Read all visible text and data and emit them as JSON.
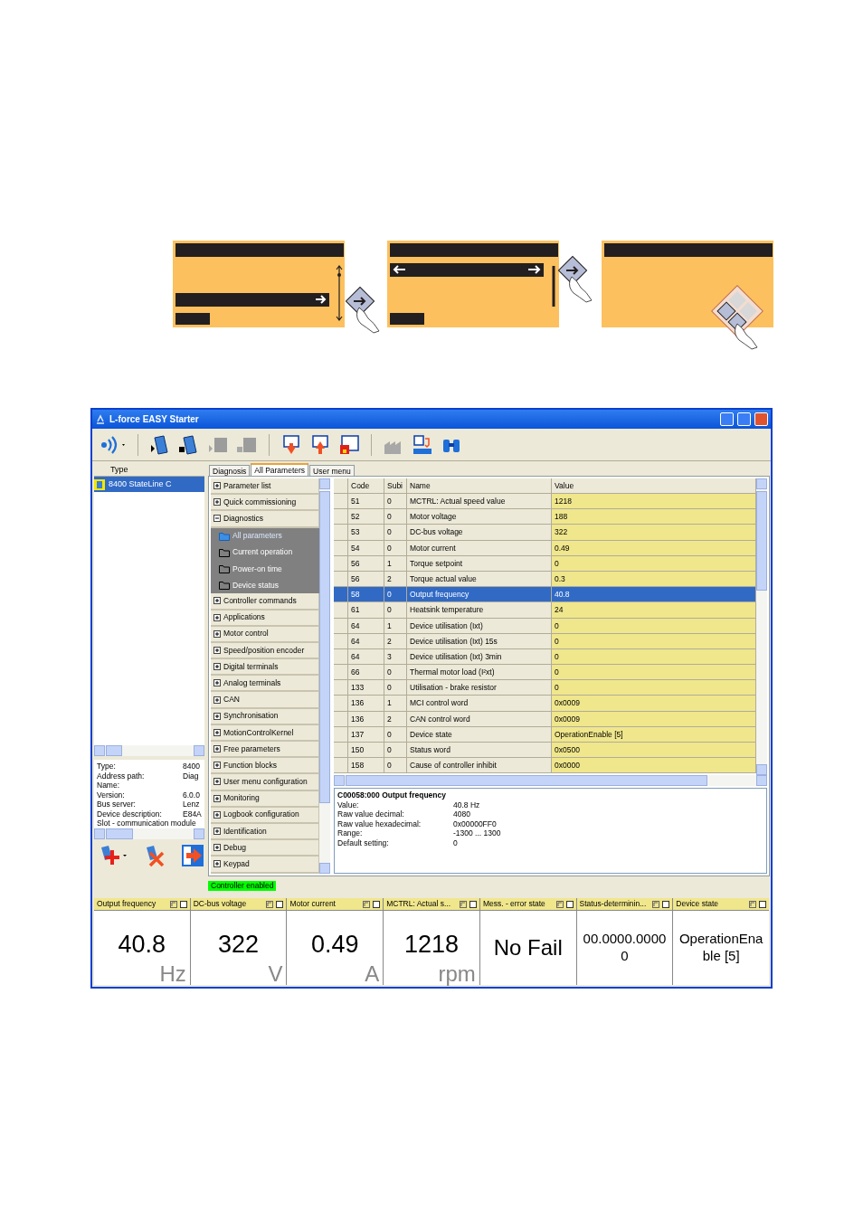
{
  "keypad_illustrations": [
    {
      "kind": "vertical"
    },
    {
      "kind": "horizontal"
    },
    {
      "kind": "navigation"
    }
  ],
  "window": {
    "title": "L-force EASY Starter"
  },
  "left_panel": {
    "header": "Type",
    "devices": [
      {
        "label": "8400 StateLine C",
        "selected": true
      }
    ],
    "info": [
      {
        "label": "Type:",
        "value": "8400"
      },
      {
        "label": "Address path:",
        "value": "Diag"
      },
      {
        "label": "Name:"
      },
      {
        "label": "Version:",
        "value": "6.0.0"
      },
      {
        "label": "Bus server:",
        "value": "Lenz"
      },
      {
        "label": "Device description:",
        "value": "E84A"
      },
      {
        "label": "Slot - communication module"
      }
    ]
  },
  "tabs": [
    {
      "label": "Diagnosis",
      "selected": false
    },
    {
      "label": "All Parameters",
      "selected": true
    },
    {
      "label": "User menu",
      "selected": false
    }
  ],
  "tree": [
    {
      "label": "Parameter list",
      "expanded": false
    },
    {
      "label": "Quick commissioning",
      "expanded": false
    },
    {
      "label": "Diagnostics",
      "expanded": true,
      "children": [
        {
          "label": "All parameters",
          "selected": true
        },
        {
          "label": "Current operation",
          "selected": false
        },
        {
          "label": "Power-on time",
          "selected": false
        },
        {
          "label": "Device status",
          "selected": false
        }
      ]
    },
    {
      "label": "Controller commands",
      "expanded": false
    },
    {
      "label": "Applications",
      "expanded": false
    },
    {
      "label": "Motor control",
      "expanded": false
    },
    {
      "label": "Speed/position encoder",
      "expanded": false
    },
    {
      "label": "Digital terminals",
      "expanded": false
    },
    {
      "label": "Analog terminals",
      "expanded": false
    },
    {
      "label": "CAN",
      "expanded": false
    },
    {
      "label": "Synchronisation",
      "expanded": false
    },
    {
      "label": "MotionControlKernel",
      "expanded": false
    },
    {
      "label": "Free parameters",
      "expanded": false
    },
    {
      "label": "Function blocks",
      "expanded": false
    },
    {
      "label": "User menu configuration",
      "expanded": false
    },
    {
      "label": "Monitoring",
      "expanded": false
    },
    {
      "label": "Logbook configuration",
      "expanded": false
    },
    {
      "label": "Identification",
      "expanded": false
    },
    {
      "label": "Debug",
      "expanded": false
    },
    {
      "label": "Keypad",
      "expanded": false
    }
  ],
  "table": {
    "columns": [
      "Code",
      "Subi",
      "Name",
      "Value"
    ],
    "rows": [
      {
        "code": "51",
        "sub": "0",
        "name": "MCTRL: Actual speed value",
        "value": "1218",
        "selected": false
      },
      {
        "code": "52",
        "sub": "0",
        "name": "Motor voltage",
        "value": "188",
        "selected": false
      },
      {
        "code": "53",
        "sub": "0",
        "name": "DC-bus voltage",
        "value": "322",
        "selected": false
      },
      {
        "code": "54",
        "sub": "0",
        "name": "Motor current",
        "value": "0.49",
        "selected": false
      },
      {
        "code": "56",
        "sub": "1",
        "name": "Torque setpoint",
        "value": "0",
        "selected": false
      },
      {
        "code": "56",
        "sub": "2",
        "name": "Torque actual value",
        "value": "0.3",
        "selected": false
      },
      {
        "code": "58",
        "sub": "0",
        "name": "Output frequency",
        "value": "40.8",
        "selected": true
      },
      {
        "code": "61",
        "sub": "0",
        "name": "Heatsink temperature",
        "value": "24",
        "selected": false
      },
      {
        "code": "64",
        "sub": "1",
        "name": "Device utilisation (Ixt)",
        "value": "0",
        "selected": false
      },
      {
        "code": "64",
        "sub": "2",
        "name": "Device utilisation (Ixt) 15s",
        "value": "0",
        "selected": false
      },
      {
        "code": "64",
        "sub": "3",
        "name": "Device utilisation (Ixt) 3min",
        "value": "0",
        "selected": false
      },
      {
        "code": "66",
        "sub": "0",
        "name": "Thermal motor load (I²xt)",
        "value": "0",
        "selected": false
      },
      {
        "code": "133",
        "sub": "0",
        "name": "Utilisation - brake resistor",
        "value": "0",
        "selected": false
      },
      {
        "code": "136",
        "sub": "1",
        "name": "MCI control word",
        "value": "0x0009",
        "selected": false
      },
      {
        "code": "136",
        "sub": "2",
        "name": "CAN control word",
        "value": "0x0009",
        "selected": false
      },
      {
        "code": "137",
        "sub": "0",
        "name": "Device state",
        "value": "OperationEnable [5]",
        "selected": false
      },
      {
        "code": "150",
        "sub": "0",
        "name": "Status word",
        "value": "0x0500",
        "selected": false
      },
      {
        "code": "158",
        "sub": "0",
        "name": "Cause of controller inhibit",
        "value": "0x0000",
        "selected": false
      }
    ]
  },
  "details": {
    "title": "C00058:000 Output frequency",
    "rows": [
      {
        "label": "Value:",
        "value": "40.8 Hz"
      },
      {
        "label": "Raw value decimal:",
        "value": "4080"
      },
      {
        "label": "Raw value hexadecimal:",
        "value": "0x00000FF0"
      },
      {
        "label": "Range:",
        "value": "-1300 ... 1300"
      },
      {
        "label": "Default setting:",
        "value": "0"
      }
    ]
  },
  "status_badge": "Controller enabled",
  "monitors": [
    {
      "title": "Output frequency",
      "value": "40.8",
      "unit": "Hz"
    },
    {
      "title": "DC-bus voltage",
      "value": "322",
      "unit": "V"
    },
    {
      "title": "Motor current",
      "value": "0.49",
      "unit": "A"
    },
    {
      "title": "MCTRL: Actual s...",
      "value": "1218",
      "unit": "rpm"
    },
    {
      "title": "Mess. - error state",
      "value": "No Fail"
    },
    {
      "title": "Status-determinin...",
      "value": "00.0000.00000"
    },
    {
      "title": "Device state",
      "value": "OperationEnable [5]"
    }
  ]
}
